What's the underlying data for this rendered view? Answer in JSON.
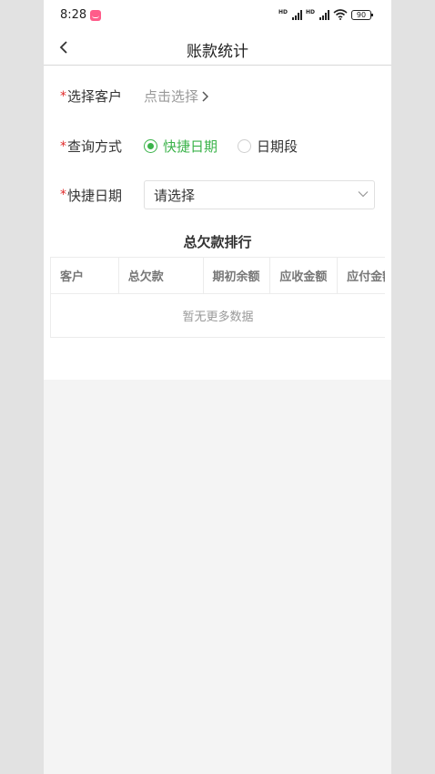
{
  "status_bar": {
    "time": "8:28",
    "battery": "90",
    "sig1": "HD",
    "sig2": "HD"
  },
  "nav": {
    "title": "账款统计"
  },
  "form": {
    "customer": {
      "required_mark": "*",
      "label": "选择客户",
      "placeholder": "点击选择"
    },
    "query_mode": {
      "required_mark": "*",
      "label": "查询方式",
      "options": [
        {
          "label": "快捷日期",
          "checked": true
        },
        {
          "label": "日期段",
          "checked": false
        }
      ]
    },
    "quick_date": {
      "required_mark": "*",
      "label": "快捷日期",
      "value": "请选择"
    }
  },
  "ranking": {
    "title": "总欠款排行",
    "columns": [
      "客户",
      "总欠款",
      "期初余额",
      "应收金额",
      "应付金额"
    ],
    "empty_text": "暂无更多数据"
  },
  "colors": {
    "accent": "#3bb34a",
    "required": "#e02b2b",
    "badge": "#ff5c8a"
  }
}
